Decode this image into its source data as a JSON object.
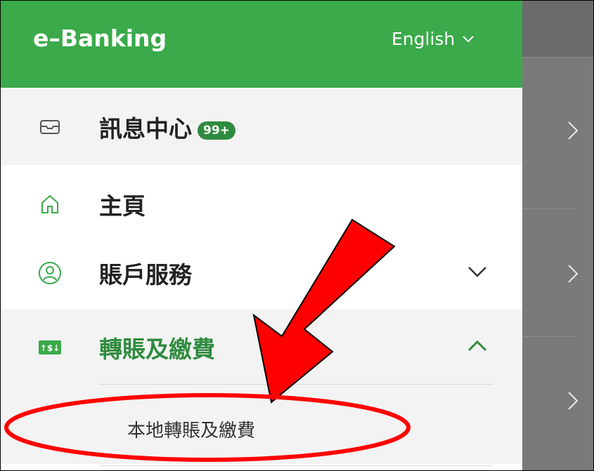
{
  "header": {
    "app_title": "e–Banking",
    "language_label": "English"
  },
  "menu": {
    "inbox": {
      "label": "訊息中心",
      "badge": "99+"
    },
    "home": {
      "label": "主頁"
    },
    "account_services": {
      "label": "賬戶服務"
    },
    "transfer_payment": {
      "label": "轉賬及繳費"
    },
    "submenu": {
      "local_transfer": {
        "label": "本地轉賬及繳費"
      }
    }
  },
  "colors": {
    "brand_green": "#3aaa4a",
    "badge_green": "#2f8b3f",
    "annotation_red": "#ff0000"
  }
}
